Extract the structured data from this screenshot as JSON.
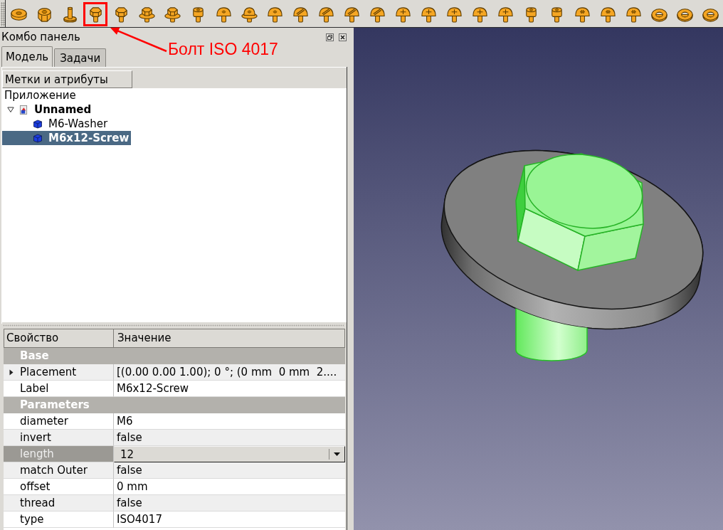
{
  "toolbar": {
    "buttons": [
      {
        "kind": "flat-head",
        "marked": false
      },
      {
        "kind": "nut",
        "marked": false
      },
      {
        "kind": "pin",
        "marked": false
      },
      {
        "kind": "hex-bolt",
        "marked": true
      },
      {
        "kind": "hex-bolt",
        "marked": false
      },
      {
        "kind": "flange-bolt",
        "marked": false
      },
      {
        "kind": "flange-bolt",
        "marked": false
      },
      {
        "kind": "socket-screw",
        "marked": false
      },
      {
        "kind": "button-screw",
        "marked": false
      },
      {
        "kind": "flange-screw",
        "marked": false
      },
      {
        "kind": "button-screw",
        "marked": false
      },
      {
        "kind": "slotted-screw",
        "marked": false
      },
      {
        "kind": "slotted-screw",
        "marked": false
      },
      {
        "kind": "slotted-screw",
        "marked": false
      },
      {
        "kind": "slotted-screw",
        "marked": false
      },
      {
        "kind": "cross-screw",
        "marked": false
      },
      {
        "kind": "cross-screw",
        "marked": false
      },
      {
        "kind": "cross-screw",
        "marked": false
      },
      {
        "kind": "cross-screw",
        "marked": false
      },
      {
        "kind": "cross-screw",
        "marked": false
      },
      {
        "kind": "socket-screw",
        "marked": false
      },
      {
        "kind": "socket-screw",
        "marked": false
      },
      {
        "kind": "star-screw",
        "marked": false
      },
      {
        "kind": "star-screw",
        "marked": false
      },
      {
        "kind": "star-screw",
        "marked": false
      },
      {
        "kind": "washer",
        "marked": false
      },
      {
        "kind": "washer",
        "marked": false
      },
      {
        "kind": "washer",
        "marked": false
      }
    ]
  },
  "callout": {
    "text": "Болт ISO 4017"
  },
  "combo_panel": {
    "title": "Комбо панель",
    "tabs": [
      {
        "label": "Модель",
        "selected": true
      },
      {
        "label": "Задачи",
        "selected": false
      }
    ],
    "labels_button": "Метки и атрибуты",
    "tree": {
      "root": "Приложение",
      "items": [
        {
          "label": "Unnamed",
          "kind": "document",
          "expanded": true,
          "selected": false,
          "children": [
            {
              "label": "M6-Washer",
              "kind": "solid",
              "selected": false
            },
            {
              "label": "M6x12-Screw",
              "kind": "solid",
              "selected": true
            }
          ]
        }
      ]
    }
  },
  "property_view": {
    "columns": [
      "Свойство",
      "Значение"
    ],
    "rows": [
      {
        "kind": "group",
        "name": "Base",
        "selected": false
      },
      {
        "kind": "property",
        "name": "Placement",
        "value": "[(0.00 0.00 1.00); 0 °; (0 mm  0 mm  2....",
        "expanded": false,
        "selected": false
      },
      {
        "kind": "property",
        "name": "Label",
        "value": "M6x12-Screw",
        "selected": false
      },
      {
        "kind": "group",
        "name": "Parameters",
        "selected": false
      },
      {
        "kind": "property",
        "name": "diameter",
        "value": "M6",
        "selected": false
      },
      {
        "kind": "property",
        "name": "invert",
        "value": "false",
        "selected": false
      },
      {
        "kind": "property",
        "name": "length",
        "value": "12",
        "selected": true
      },
      {
        "kind": "property",
        "name": "match Outer",
        "value": "false",
        "selected": false
      },
      {
        "kind": "property",
        "name": "offset",
        "value": "0 mm",
        "selected": false
      },
      {
        "kind": "property",
        "name": "thread",
        "value": "false",
        "selected": false
      },
      {
        "kind": "property",
        "name": "type",
        "value": "ISO4017",
        "selected": false
      }
    ]
  }
}
